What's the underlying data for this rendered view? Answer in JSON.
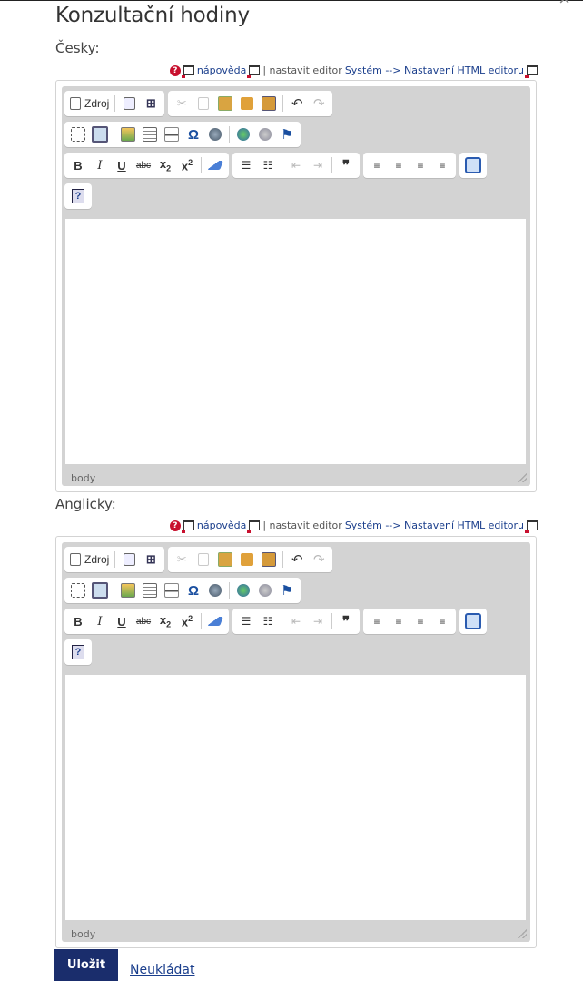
{
  "dialog": {
    "title": "Konzultační hodiny",
    "close_icon": "close-icon"
  },
  "editors": [
    {
      "label": "Česky:",
      "status": "body"
    },
    {
      "label": "Anglicky:",
      "status": "body"
    }
  ],
  "helpbar": {
    "help_link": "nápověda",
    "sep": "| nastavit editor",
    "settings_link": "Systém --> Nastavení HTML editoru"
  },
  "toolbar": {
    "source_label": "Zdroj",
    "icons_row1": [
      "document-icon",
      "preview-icon",
      "find-icon",
      "cut-icon",
      "copy-icon",
      "paste-icon",
      "paste-text-icon",
      "paste-word-icon",
      "undo-icon",
      "redo-icon"
    ],
    "icons_row2": [
      "select-all-icon",
      "maximize-icon",
      "image-icon",
      "table-icon",
      "horizontal-line-icon",
      "special-char-icon",
      "iframe-icon",
      "link-icon",
      "unlink-icon",
      "anchor-icon"
    ],
    "icons_row3": [
      "bold-icon",
      "italic-icon",
      "underline-icon",
      "strike-icon",
      "subscript-icon",
      "superscript-icon",
      "remove-format-icon",
      "numbered-list-icon",
      "bulleted-list-icon",
      "outdent-icon",
      "indent-icon",
      "blockquote-icon",
      "align-left-icon",
      "align-center-icon",
      "align-right-icon",
      "justify-icon",
      "show-blocks-icon"
    ],
    "icons_row4": [
      "about-icon"
    ]
  },
  "actions": {
    "save_label": "Uložit",
    "cancel_label": "Neukládat"
  },
  "colors": {
    "primary": "#1a2d6c",
    "link": "#1a3e8c",
    "help_red": "#c8102e",
    "editor_chrome": "#d3d3d3"
  }
}
